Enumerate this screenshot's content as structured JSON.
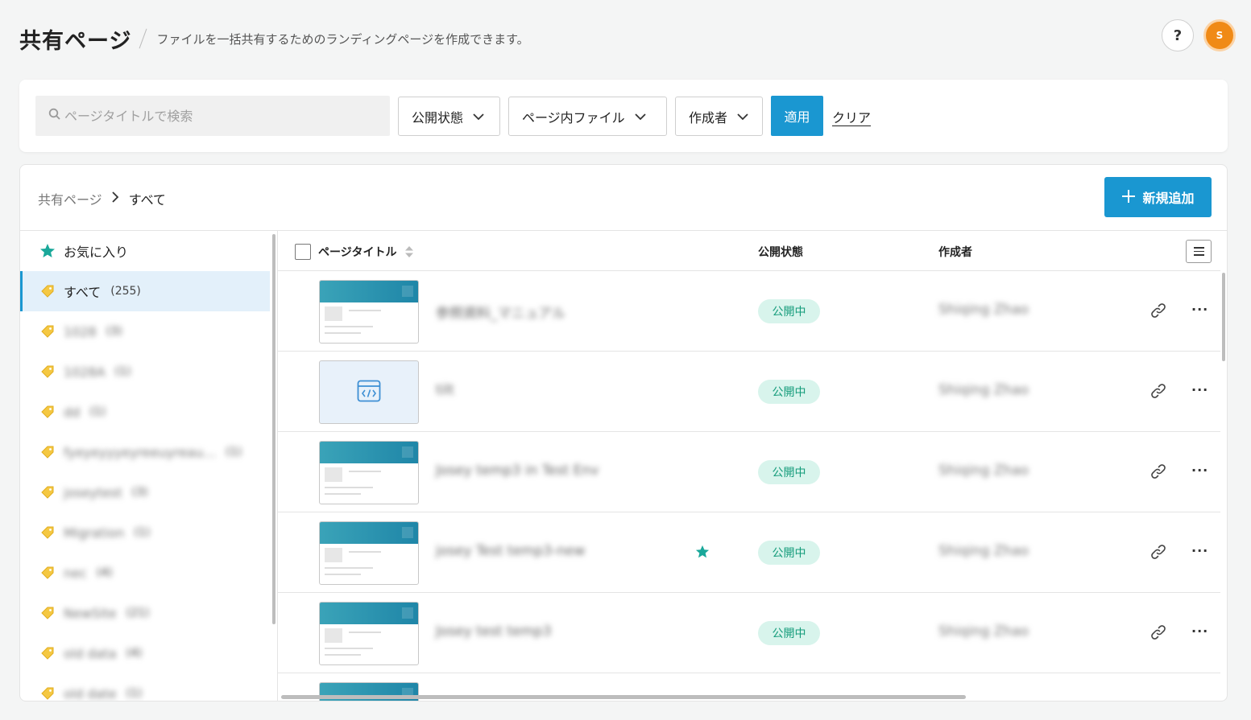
{
  "header": {
    "title": "共有ページ",
    "subtitle": "ファイルを一括共有するためのランディングページを作成できます。",
    "help_label": "?",
    "avatar_initial": "S"
  },
  "filters": {
    "search_placeholder": "ページタイトルで検索",
    "status_label": "公開状態",
    "files_label": "ページ内ファイル",
    "author_label": "作成者",
    "apply_label": "適用",
    "clear_label": "クリア"
  },
  "breadcrumb": {
    "root": "共有ページ",
    "current": "すべて"
  },
  "add_button": {
    "label": "新規追加"
  },
  "sidebar": {
    "favorites": "お気に入り",
    "all": {
      "label": "すべて",
      "count": "(255)"
    },
    "tags": [
      {
        "label": "1028",
        "count": "(3)"
      },
      {
        "label": "1028A",
        "count": "(1)"
      },
      {
        "label": "dd",
        "count": "(1)"
      },
      {
        "label": "fyeyeyyyeyreeuyreau…",
        "count": "(1)"
      },
      {
        "label": "joseytest",
        "count": "(3)"
      },
      {
        "label": "Migration",
        "count": "(1)"
      },
      {
        "label": "nec",
        "count": "(4)"
      },
      {
        "label": "NewSite",
        "count": "(21)"
      },
      {
        "label": "old data",
        "count": "(4)"
      },
      {
        "label": "old date",
        "count": "(1)"
      }
    ]
  },
  "table": {
    "col_title": "ページタイトル",
    "col_status": "公開状態",
    "col_author": "作成者",
    "rows": [
      {
        "title": "参照資料_マニュアル",
        "status": "公開中",
        "author": "Shiqing Zhao",
        "favorite": false,
        "thumb": "template"
      },
      {
        "title": "tilt",
        "status": "公開中",
        "author": "Shiqing Zhao",
        "favorite": false,
        "thumb": "code"
      },
      {
        "title": "Josey temp3 in Test Env",
        "status": "公開中",
        "author": "Shiqing Zhao",
        "favorite": false,
        "thumb": "template"
      },
      {
        "title": "josey Test temp3-new",
        "status": "公開中",
        "author": "Shiqing Zhao",
        "favorite": true,
        "thumb": "template"
      },
      {
        "title": "Josey test temp3",
        "status": "公開中",
        "author": "Shiqing Zhao",
        "favorite": false,
        "thumb": "template"
      }
    ]
  },
  "colors": {
    "accent": "#1a97d1",
    "status_bg": "#d8f4ec",
    "status_text": "#139b7a",
    "star": "#1aa89a",
    "tag": "#f5c842",
    "avatar": "#f08a16"
  }
}
